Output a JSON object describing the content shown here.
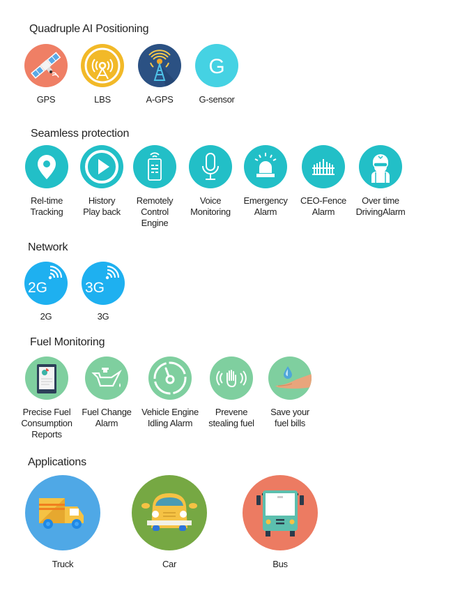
{
  "sections": {
    "positioning": {
      "title": "Quadruple AI Positioning",
      "items": [
        {
          "label": "GPS",
          "icon": "satellite-icon",
          "color": "#ef7f65"
        },
        {
          "label": "LBS",
          "icon": "signal-tower-icon",
          "color": "#f2b928"
        },
        {
          "label": "A-GPS",
          "icon": "antenna-tower-icon",
          "color": "#2b5183"
        },
        {
          "label": "G-sensor",
          "icon": "g-letter-icon",
          "color": "#45d2e3"
        }
      ]
    },
    "protection": {
      "title": "Seamless protection",
      "color": "#22bfc7",
      "items": [
        {
          "label": "Rel-time\nTracking",
          "icon": "location-pin-icon"
        },
        {
          "label": "History\nPlay back",
          "icon": "play-icon"
        },
        {
          "label": "Remotely\nControl\nEngine",
          "icon": "remote-control-icon"
        },
        {
          "label": "Voice\nMonitoring",
          "icon": "microphone-icon"
        },
        {
          "label": "Emergency\nAlarm",
          "icon": "siren-icon"
        },
        {
          "label": "CEO-Fence\nAlarm",
          "icon": "fence-icon"
        },
        {
          "label": "Over time\nDrivingAlarm",
          "icon": "driver-icon"
        }
      ]
    },
    "network": {
      "title": "Network",
      "color": "#1eb0f0",
      "items": [
        {
          "label": "2G",
          "badge": "2G",
          "icon": "2g-signal-icon"
        },
        {
          "label": "3G",
          "badge": "3G",
          "icon": "3g-signal-icon"
        }
      ]
    },
    "fuel": {
      "title": "Fuel Monitoring",
      "color": "#7fcf9f",
      "items": [
        {
          "label": "Precise Fuel\nConsumption\nReports",
          "icon": "tablet-report-icon"
        },
        {
          "label": "Fuel Change\nAlarm",
          "icon": "oil-can-icon"
        },
        {
          "label": "Vehicle Engine\nIdling Alarm",
          "icon": "idle-gauge-icon"
        },
        {
          "label": "Prevene\nstealing fuel",
          "icon": "stop-hand-icon"
        },
        {
          "label": "Save your\nfuel bills",
          "icon": "hand-drop-icon"
        }
      ]
    },
    "applications": {
      "title": "Applications",
      "items": [
        {
          "label": "Truck",
          "icon": "truck-icon",
          "color": "#4fa8e6"
        },
        {
          "label": "Car",
          "icon": "car-icon",
          "color": "#76a843"
        },
        {
          "label": "Bus",
          "icon": "bus-icon",
          "color": "#ec7b62"
        }
      ]
    }
  }
}
